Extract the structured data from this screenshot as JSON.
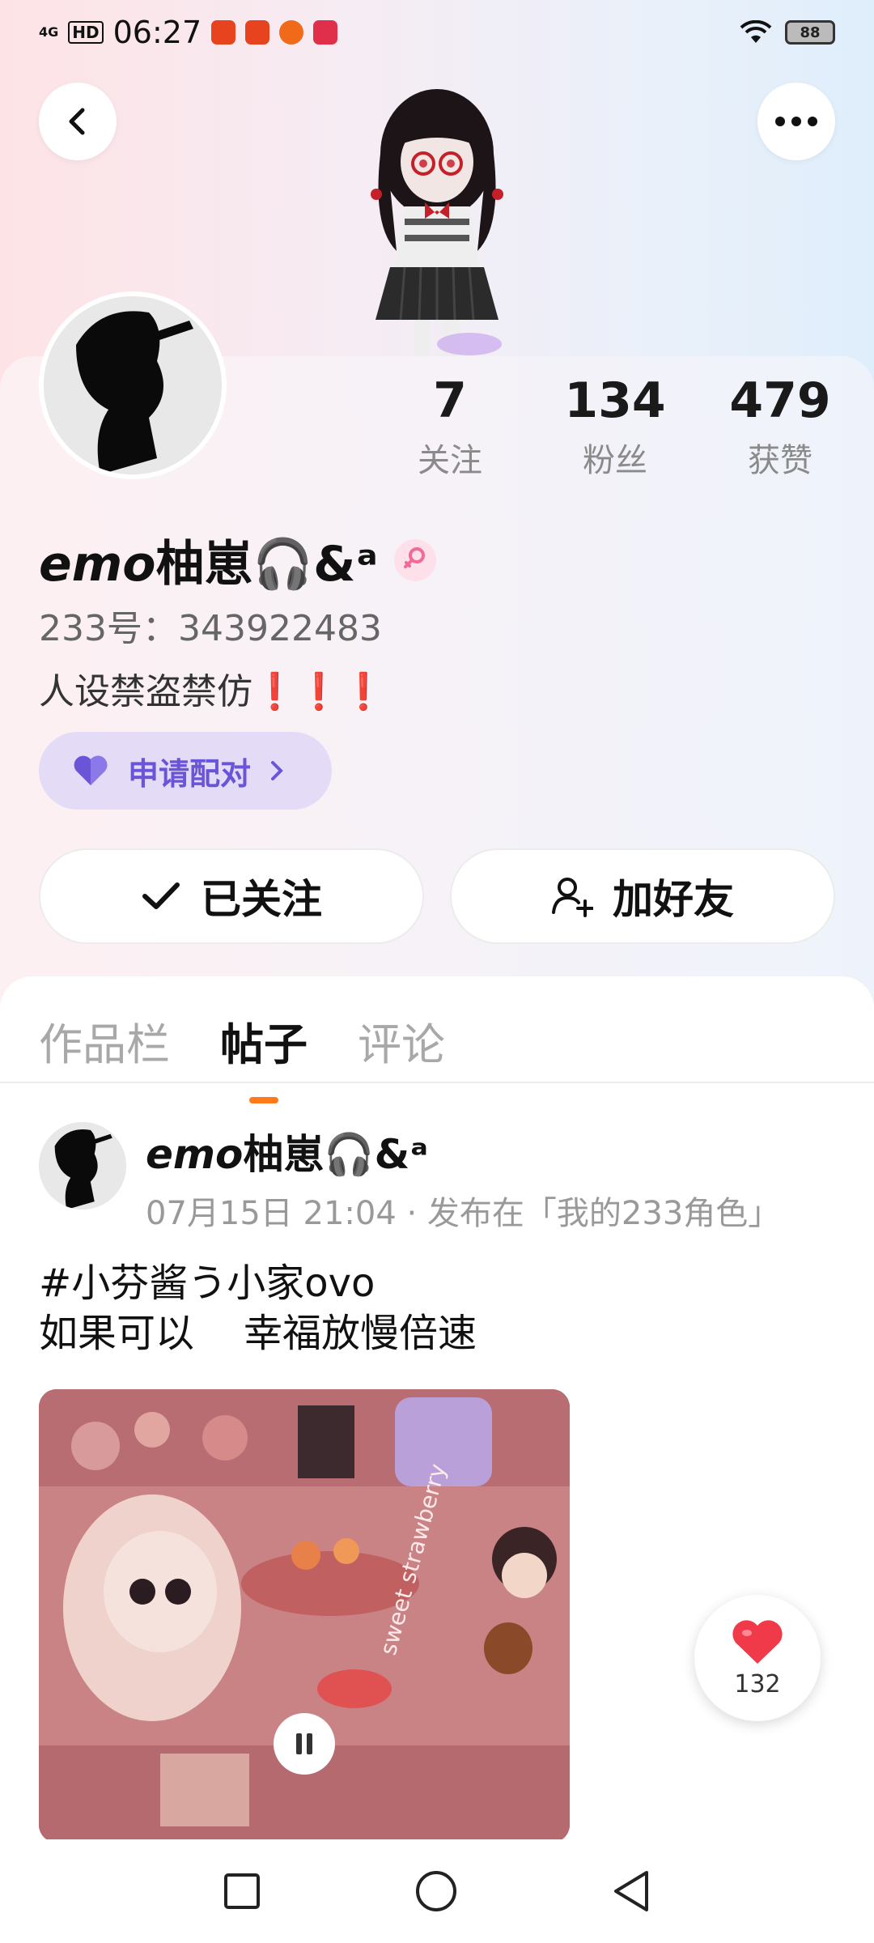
{
  "status_bar": {
    "network": "4G",
    "hd": "HD",
    "time": "06:27",
    "battery": "88"
  },
  "header": {
    "back_icon": "chevron-left-icon",
    "more_icon": "more-dots-icon"
  },
  "profile": {
    "stats": [
      {
        "value": "7",
        "label": "关注"
      },
      {
        "value": "134",
        "label": "粉丝"
      },
      {
        "value": "479",
        "label": "获赞"
      }
    ],
    "username_emo": "emo",
    "username_rest": "柚崽🎧&ᵃ",
    "gender_icon": "female-icon",
    "account_id": "233号：343922483",
    "bio_text": "人设禁盗禁仿",
    "bio_marks": "❗❗❗",
    "pair_label": "申请配对",
    "follow_label": "已关注",
    "add_friend_label": "加好友"
  },
  "tabs": [
    {
      "label": "作品栏"
    },
    {
      "label": "帖子"
    },
    {
      "label": "评论"
    }
  ],
  "post": {
    "author_emo": "emo",
    "author_rest": "柚崽🎧&ᵃ",
    "meta": "07月15日  21:04 · 发布在「我的233角色」",
    "line1": "#小芬酱う小家ovo",
    "line2": "如果可以    幸福放慢倍速",
    "likes": "132"
  },
  "colors": {
    "accent": "#ff7a1a",
    "pair": "#6a55d8",
    "like": "#f03a4a"
  }
}
